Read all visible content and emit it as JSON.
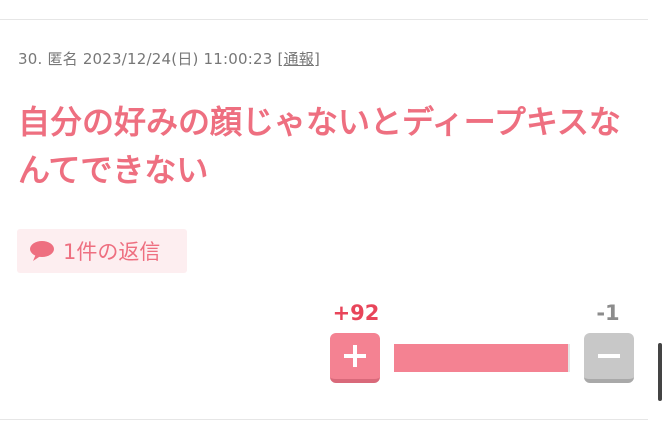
{
  "comment": {
    "number": "30.",
    "author": "匿名",
    "datetime": "2023/12/24(日) 11:00:23",
    "report_open": "[",
    "report_label": "通報",
    "report_close": "]",
    "text": "自分の好みの顔じゃないとディープキスなんてできない"
  },
  "reply": {
    "label": "1件の返信",
    "icon": "speech-bubble-icon"
  },
  "votes": {
    "plus_label": "+92",
    "minus_label": "-1",
    "plus": 92,
    "minus": 1,
    "plus_share": 0.989
  },
  "colors": {
    "accent": "#ee6f80",
    "plus": "#f48292",
    "plus_count": "#e8455a",
    "minus": "#c8c8c8",
    "reply_bg": "#fdeef0",
    "meta_text": "#777777"
  }
}
